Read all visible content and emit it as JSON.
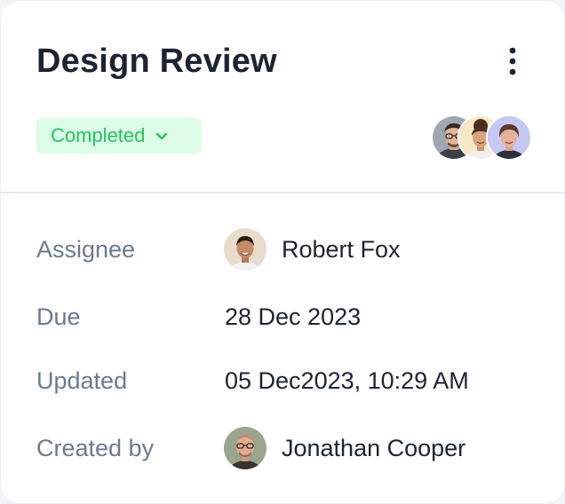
{
  "card": {
    "title": "Design Review",
    "menu_icon": "more-vertical-icon"
  },
  "status": {
    "label": "Completed",
    "icon": "chevron-down-icon",
    "color": "#22c55e",
    "background": "#dcfce7"
  },
  "collaborators": [
    {
      "icon": "avatar-man-glasses"
    },
    {
      "icon": "avatar-woman-curly-hair"
    },
    {
      "icon": "avatar-woman-short-hair"
    }
  ],
  "details": {
    "assignee": {
      "label": "Assignee",
      "value": "Robert Fox",
      "icon": "avatar-robert-fox"
    },
    "due": {
      "label": "Due",
      "value": "28 Dec 2023"
    },
    "updated": {
      "label": "Updated",
      "value": "05 Dec2023, 10:29 AM"
    },
    "created_by": {
      "label": "Created by",
      "value": "Jonathan Cooper",
      "icon": "avatar-jonathan-cooper"
    }
  },
  "colors": {
    "title": "#1c2434",
    "label": "#6b7a90",
    "divider": "#e6e8ee"
  }
}
